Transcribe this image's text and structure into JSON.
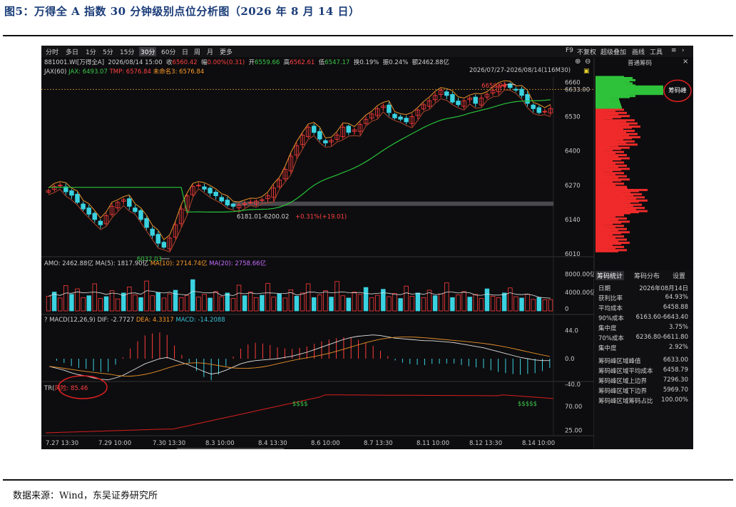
{
  "figure": {
    "title": "图5：万得全 A 指数 30 分钟级别点位分析图（2026 年 8 月 14 日）",
    "source": "数据来源：Wind，东吴证券研究所"
  },
  "toolbar": {
    "periods": [
      "分时",
      "多日",
      "1分",
      "5分",
      "15分",
      "30分",
      "60分",
      "日",
      "周",
      "月",
      "更多"
    ],
    "active_period": "30分",
    "right_items": [
      "F9",
      "不复权",
      "超级叠加",
      "画线",
      "工具"
    ]
  },
  "header": {
    "symbol": "881001.WI[万得全A]",
    "datetime": "2026/08/14 15:00",
    "close_label": "收",
    "close": "6560.42",
    "change_label": "幅",
    "change": "0.00%(0.31)",
    "open_label": "开",
    "open": "6559.66",
    "high_label": "高",
    "high": "6562.61",
    "low_label": "低",
    "low": "6547.17",
    "turnover_label": "换",
    "turnover": "0.19%",
    "amplitude_label": "振",
    "amplitude": "0.24%",
    "amount_label": "额",
    "amount": "2462.88亿",
    "range": "2026/07/27-2026/08/14(116M30)",
    "jax": "JAX(60)",
    "jax_value": "JAX: 6493.07",
    "tmp_value": "TMP: 6576.84",
    "unnamed_value": "未命名3: 6576.84",
    "chip_tab": "普通筹码"
  },
  "amo": {
    "label": "AMO: 2462.88亿",
    "ma5": "MA(5): 1817.90亿",
    "ma10": "MA(10): 2714.74亿",
    "ma20": "MA(20): 2758.66亿",
    "axis": [
      "8000.00亿",
      "4000.00亿",
      "0"
    ]
  },
  "macd": {
    "label": "MACD(12,26,9)",
    "dif": "DIF: -2.7727",
    "dea": "DEA: 4.3317",
    "macd": "MACD: -14.2088",
    "axis": [
      "44.0",
      "0.0",
      "-40.0"
    ]
  },
  "tr": {
    "label": "TR(",
    "risk": "风险: 85.46",
    "axis": [
      "70.00",
      "25.00"
    ],
    "sell_mark": "$$$$",
    "sell_mark2": "$$$$$"
  },
  "price_axis": [
    "6660",
    "6633.00",
    "6530",
    "6400",
    "6270",
    "6140",
    "6010"
  ],
  "annotations": {
    "peak": "6650.94",
    "low": "6032.03",
    "support": "6181.01-6200.02",
    "support_pct": "+0.31%(+19.01)",
    "chip_peak": "筹码峰"
  },
  "x_axis": [
    "7.27 13:30",
    "7.29 10:00",
    "7.30 13:30",
    "8.3 10:00",
    "8.4 13:30",
    "8.6 10:00",
    "8.7 13:30",
    "8.11 10:00",
    "8.12 13:30",
    "8.14 10:00"
  ],
  "panel": {
    "tabs": [
      "筹码统计",
      "筹码分布",
      "设置"
    ],
    "rows": [
      {
        "k": "日期",
        "v": "2026年08月14日"
      },
      {
        "k": "获利比率",
        "v": "64.93%"
      },
      {
        "k": "平均成本",
        "v": "6458.88"
      },
      {
        "k": "90%成本",
        "v": "6163.60-6643.40"
      },
      {
        "k": "集中度",
        "v": "3.75%"
      },
      {
        "k": "70%成本",
        "v": "6236.80-6611.80"
      },
      {
        "k": "集中度",
        "v": "2.92%"
      },
      {
        "k": "筹码峰区域峰值",
        "v": "6633.00"
      },
      {
        "k": "筹码峰区域平均成本",
        "v": "6458.79"
      },
      {
        "k": "筹码峰区域上边界",
        "v": "7296.30"
      },
      {
        "k": "筹码峰区域下边界",
        "v": "5969.70"
      },
      {
        "k": "筹码峰区域筹码占比",
        "v": "100.00%"
      }
    ]
  },
  "colors": {
    "up": "#ff3b3b",
    "down": "#3ad2e0",
    "bg": "#0d0d0f",
    "ma_orange": "#e8912a",
    "ma_green": "#27c23a"
  },
  "chart_data": {
    "type": "candlestick",
    "series": [
      {
        "name": "JAX",
        "values": [
          6493.07
        ]
      },
      {
        "name": "TMP",
        "values": [
          6576.84
        ]
      }
    ],
    "key_levels": {
      "high": 6650.94,
      "low": 6032.03,
      "support_low": 6181.01,
      "support_high": 6200.02,
      "chip_peak": 6633.0
    },
    "ylim": [
      6010,
      6680
    ],
    "close_path": [
      6250,
      6265,
      6270,
      6245,
      6232,
      6205,
      6180,
      6160,
      6140,
      6120,
      6155,
      6190,
      6205,
      6215,
      6190,
      6170,
      6140,
      6110,
      6080,
      6050,
      6035,
      6070,
      6120,
      6180,
      6230,
      6265,
      6270,
      6255,
      6240,
      6230,
      6210,
      6195,
      6190,
      6195,
      6200,
      6205,
      6210,
      6215,
      6230,
      6260,
      6290,
      6330,
      6380,
      6420,
      6460,
      6490,
      6470,
      6445,
      6430,
      6440,
      6460,
      6490,
      6470,
      6480,
      6500,
      6520,
      6540,
      6560,
      6570,
      6545,
      6525,
      6520,
      6510,
      6530,
      6555,
      6575,
      6590,
      6610,
      6630,
      6610,
      6585,
      6575,
      6590,
      6600,
      6580,
      6600,
      6615,
      6630,
      6645,
      6650,
      6640,
      6630,
      6610,
      6580,
      6560,
      6545,
      6550,
      6560
    ],
    "volume_path": [
      3.2,
      4.1,
      2.8,
      5.5,
      3.6,
      4.8,
      2.9,
      3.3,
      5.9,
      2.7,
      3.1,
      4.4,
      2.6,
      3.9,
      5.2,
      3.5,
      2.9,
      6.5,
      3.3,
      4.0,
      2.8,
      3.7,
      4.5,
      2.9,
      3.4,
      6.8,
      3.0,
      3.6,
      2.8,
      4.2,
      3.1,
      3.9,
      2.7,
      5.6,
      3.3,
      4.1,
      2.9,
      3.4,
      6.0,
      3.0,
      3.7,
      2.8,
      4.6,
      3.2,
      3.9,
      5.9,
      2.9,
      3.5,
      4.4,
      3.0,
      6.4,
      3.3,
      2.8,
      4.1,
      3.6,
      5.1,
      2.9,
      3.4,
      4.7,
      3.1,
      3.8,
      2.7,
      5.4,
      3.2,
      3.9,
      2.9,
      4.5,
      3.3,
      3.7,
      6.1,
      2.9,
      3.5,
      4.2,
      3.0,
      3.6,
      2.7,
      4.8,
      3.2,
      2.9,
      3.9,
      5.0,
      3.1,
      2.8,
      3.6,
      2.5,
      2.9,
      2.4,
      2.46
    ],
    "macd_dif_path": [
      -12,
      -15,
      -18,
      -22,
      -25,
      -27,
      -30,
      -32,
      -33,
      -30,
      -26,
      -20,
      -14,
      -8,
      -4,
      0,
      2,
      -2,
      -6,
      -10,
      -15,
      -20,
      -24,
      -22,
      -18,
      -13,
      -8,
      -5,
      -3,
      -2,
      -1,
      0,
      2,
      4,
      7,
      10,
      14,
      18,
      22,
      26,
      30,
      33,
      35,
      36,
      37,
      36,
      34,
      32,
      31,
      30,
      29,
      28,
      28,
      27,
      26,
      25,
      23,
      21,
      19,
      17,
      14,
      11,
      8,
      5,
      2,
      0,
      -2,
      -3,
      -3
    ]
  }
}
